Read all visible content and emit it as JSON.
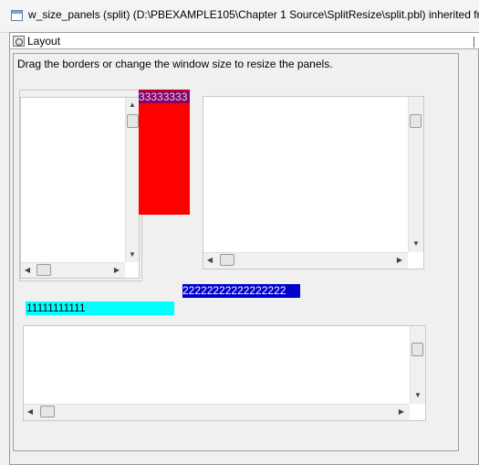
{
  "window": {
    "title": "w_size_panels (split) (D:\\PBEXAMPLE105\\Chapter 1 Source\\SplitResize\\split.pbl) inherited from"
  },
  "inner_window": {
    "title": "Layout"
  },
  "instructions": "Drag the borders or change the window size to resize the panels.",
  "splitters": {
    "vertical_text": "33333333",
    "horizontal_blue_text": "22222222222222222",
    "horizontal_cyan_text": "11111111111"
  },
  "scroll_glyphs": {
    "up": "▲",
    "down": "▼",
    "left": "◀",
    "right": "▶"
  },
  "colors": {
    "vertical_splitter": "#ff0000",
    "horizontal_splitter_blue": "#0000cc",
    "horizontal_splitter_cyan": "#00ffff"
  }
}
